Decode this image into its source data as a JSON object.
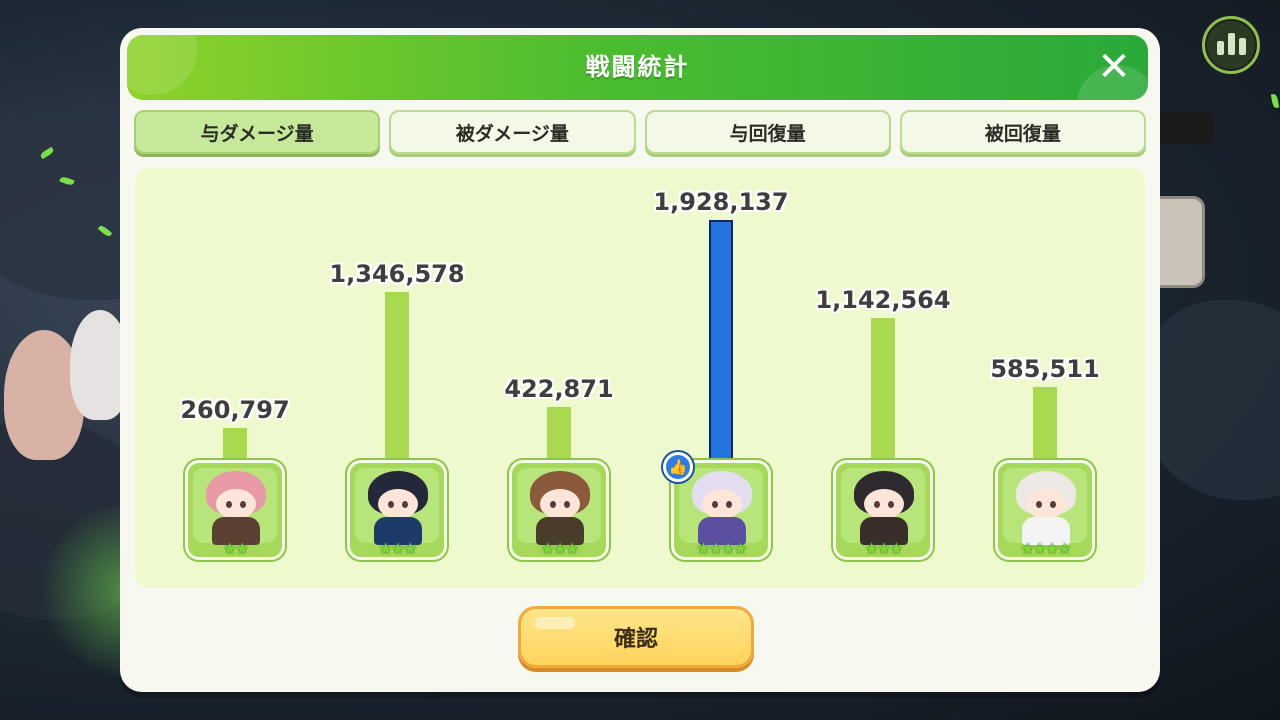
{
  "dialog": {
    "title": "戦闘統計",
    "close_icon": "close-icon",
    "confirm_label": "確認"
  },
  "tabs": [
    {
      "label": "与ダメージ量",
      "active": true
    },
    {
      "label": "被ダメージ量",
      "active": false
    },
    {
      "label": "与回復量",
      "active": false
    },
    {
      "label": "被回復量",
      "active": false
    }
  ],
  "characters": [
    {
      "value_label": "260,797",
      "stars": "★★",
      "mvp": false
    },
    {
      "value_label": "1,346,578",
      "stars": "★★★",
      "mvp": false
    },
    {
      "value_label": "422,871",
      "stars": "★★★",
      "mvp": false
    },
    {
      "value_label": "1,928,137",
      "stars": "★★★★",
      "mvp": true
    },
    {
      "value_label": "1,142,564",
      "stars": "★★★",
      "mvp": false
    },
    {
      "value_label": "585,511",
      "stars": "★★★★",
      "mvp": false
    }
  ],
  "chart_data": {
    "type": "bar",
    "categories": [
      "",
      "",
      "",
      "",
      "",
      ""
    ],
    "values": [
      260797,
      1346578,
      422871,
      1928137,
      1142564,
      585511
    ],
    "title": "",
    "xlabel": "",
    "ylabel": "",
    "ylim": [
      0,
      1928137
    ]
  },
  "colors": {
    "bar": "#a9d94f",
    "mvp_bar": "#2373e0",
    "header_start": "#8fd22a",
    "header_end": "#2aa93a"
  },
  "icons": {
    "stats": "bar-chart-icon",
    "mvp": "mvp-badge-icon"
  }
}
